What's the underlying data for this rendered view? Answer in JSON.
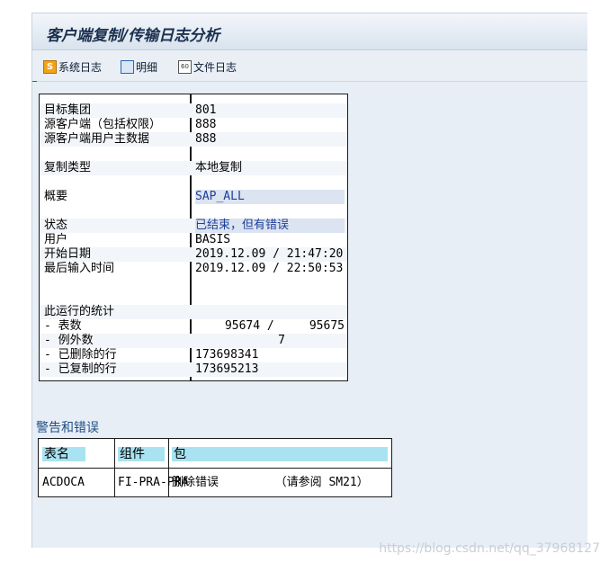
{
  "window": {
    "title": "客户端复制/传输日志分析"
  },
  "toolbar": {
    "system_log": {
      "label": "系统日志",
      "icon": "system-log-icon"
    },
    "details": {
      "label": "明细",
      "icon": "details-icon"
    },
    "file_log": {
      "label": "文件日志",
      "icon": "file-log-icon"
    }
  },
  "info": {
    "target_client_label": "目标集团",
    "target_client_value": "801",
    "source_client_label": "源客户端（包括权限）",
    "source_client_value": "888",
    "source_user_master_label": "源客户端用户主数据",
    "source_user_master_value": "888",
    "copy_type_label": "复制类型",
    "copy_type_value": "本地复制",
    "profile_label": "概要",
    "profile_value": "SAP_ALL",
    "status_label": "状态",
    "status_value": "已结束，但有错误",
    "user_label": "用户",
    "user_value": "BASIS",
    "start_date_label": "开始日期",
    "start_date_value": "2019.12.09 / 21:47:20",
    "last_entry_label": "最后输入时间",
    "last_entry_value": "2019.12.09 / 22:50:53",
    "stats_label": "此运行的统计",
    "tables_label": "- 表数",
    "tables_value": "95674 /     95675",
    "exceptions_label": "- 例外数",
    "exceptions_value": "7",
    "deleted_label": "- 已删除的行",
    "deleted_value": "173698341",
    "copied_label": "- 已复制的行",
    "copied_value": "173695213"
  },
  "warnings": {
    "title": "警告和错误",
    "headers": {
      "table": "表名",
      "component": "组件",
      "package": "包"
    },
    "rows": [
      {
        "table": "ACDOCA",
        "component": "FI-PRA-PRA",
        "package": "删除错误        （请参阅 SM21）"
      }
    ]
  },
  "watermark": "https://blog.csdn.net/qq_37968127",
  "colors": {
    "title_text": "#1a2f4f",
    "highlight_value": "#1f3e9a",
    "header_cell": "#a9e3f1",
    "section_title": "#1e4e86"
  }
}
